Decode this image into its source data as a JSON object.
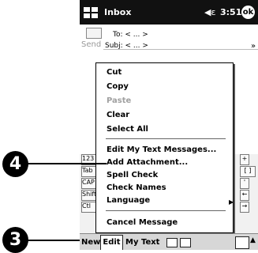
{
  "titlebar": {
    "title": "Inbox",
    "volume": "◀ε",
    "time": "3:51",
    "ok": "ok"
  },
  "compose": {
    "send_label": "Send",
    "to": "To: < ... >",
    "subj": "Subj: < ... >",
    "expand": "»"
  },
  "menu": {
    "items": [
      {
        "label": "Cut",
        "disabled": false
      },
      {
        "label": "Copy",
        "disabled": false
      },
      {
        "label": "Paste",
        "disabled": true
      },
      {
        "label": "Clear",
        "disabled": false
      },
      {
        "label": "Select All",
        "disabled": false
      },
      {
        "label": "Edit My Text Messages...",
        "disabled": false
      },
      {
        "label": "Add Attachment...",
        "disabled": false
      },
      {
        "label": "Spell Check",
        "disabled": false
      },
      {
        "label": "Check Names",
        "disabled": false
      },
      {
        "label": "Language",
        "disabled": false
      },
      {
        "label": "Cancel Message",
        "disabled": false
      }
    ],
    "submenu_arrow": "▶"
  },
  "keyboard": {
    "rows": [
      "123",
      "Tab",
      "CAP",
      "Shift",
      "Ctl"
    ],
    "right": [
      "+",
      "[ ]",
      "'",
      "←",
      "→"
    ]
  },
  "bottombar": {
    "new": "New",
    "edit": "Edit",
    "mytext": "My Text"
  },
  "callouts": {
    "four": "4",
    "three": "3"
  }
}
